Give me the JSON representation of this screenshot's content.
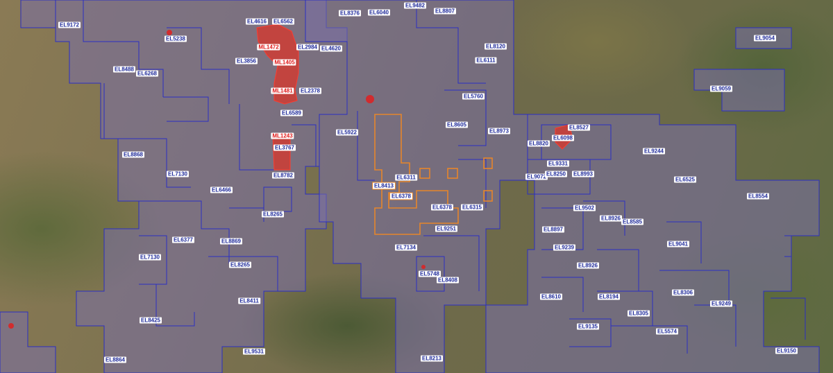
{
  "map": {
    "colors": {
      "exploration_outline": "#2b2fc2",
      "exploration_fill": "#7a6fa8",
      "mining_fill": "#d9352a",
      "application_outline": "#e6862b"
    },
    "labels": [
      {
        "type": "el",
        "text": "EL9172"
      },
      {
        "type": "el",
        "text": "EL5238"
      },
      {
        "type": "el",
        "text": "EL4616"
      },
      {
        "type": "el",
        "text": "EL6562"
      },
      {
        "type": "el",
        "text": "EL8376"
      },
      {
        "type": "el",
        "text": "EL6040"
      },
      {
        "type": "el",
        "text": "EL9482"
      },
      {
        "type": "el",
        "text": "EL8807"
      },
      {
        "type": "ml",
        "text": "ML1472"
      },
      {
        "type": "el",
        "text": "EL2984"
      },
      {
        "type": "el",
        "text": "EL4620"
      },
      {
        "type": "el",
        "text": "EL8120"
      },
      {
        "type": "el",
        "text": "EL9054"
      },
      {
        "type": "el",
        "text": "EL3856"
      },
      {
        "type": "ml",
        "text": "ML1405"
      },
      {
        "type": "el",
        "text": "EL6111"
      },
      {
        "type": "el",
        "text": "EL8488"
      },
      {
        "type": "el",
        "text": "EL6268"
      },
      {
        "type": "ml",
        "text": "ML1481"
      },
      {
        "type": "el",
        "text": "EL2378"
      },
      {
        "type": "el",
        "text": "EL9059"
      },
      {
        "type": "el",
        "text": "EL5760"
      },
      {
        "type": "el",
        "text": "EL6589"
      },
      {
        "type": "el",
        "text": "EL8605"
      },
      {
        "type": "el",
        "text": "EL8527"
      },
      {
        "type": "el",
        "text": "EL5922"
      },
      {
        "type": "el",
        "text": "EL8973"
      },
      {
        "type": "ml",
        "text": "ML1243"
      },
      {
        "type": "el",
        "text": "EL6098"
      },
      {
        "type": "el",
        "text": "EL8820"
      },
      {
        "type": "el",
        "text": "EL3767"
      },
      {
        "type": "el",
        "text": "EL8868"
      },
      {
        "type": "el",
        "text": "EL9244"
      },
      {
        "type": "el",
        "text": "EL9331"
      },
      {
        "type": "el",
        "text": "EL7130"
      },
      {
        "type": "el",
        "text": "EL8782"
      },
      {
        "type": "el",
        "text": "EL6311"
      },
      {
        "type": "el",
        "text": "EL9072"
      },
      {
        "type": "el",
        "text": "EL8250"
      },
      {
        "type": "el",
        "text": "EL8993"
      },
      {
        "type": "el",
        "text": "EL6525"
      },
      {
        "type": "or",
        "text": "EL8413"
      },
      {
        "type": "el",
        "text": "EL6466"
      },
      {
        "type": "or",
        "text": "EL6378"
      },
      {
        "type": "el",
        "text": "EL8554"
      },
      {
        "type": "el",
        "text": "EL6378"
      },
      {
        "type": "el",
        "text": "EL6315"
      },
      {
        "type": "el",
        "text": "EL9502"
      },
      {
        "type": "el",
        "text": "EL8265"
      },
      {
        "type": "el",
        "text": "EL8926"
      },
      {
        "type": "el",
        "text": "EL8585"
      },
      {
        "type": "el",
        "text": "EL9251"
      },
      {
        "type": "el",
        "text": "EL8897"
      },
      {
        "type": "el",
        "text": "EL6377"
      },
      {
        "type": "el",
        "text": "EL8869"
      },
      {
        "type": "el",
        "text": "EL7134"
      },
      {
        "type": "el",
        "text": "EL9239"
      },
      {
        "type": "el",
        "text": "EL9041"
      },
      {
        "type": "el",
        "text": "EL7130"
      },
      {
        "type": "el",
        "text": "EL8265"
      },
      {
        "type": "el",
        "text": "EL8926"
      },
      {
        "type": "el",
        "text": "EL5748"
      },
      {
        "type": "el",
        "text": "EL8408"
      },
      {
        "type": "el",
        "text": "EL8610"
      },
      {
        "type": "el",
        "text": "EL8194"
      },
      {
        "type": "el",
        "text": "EL8306"
      },
      {
        "type": "el",
        "text": "EL8411"
      },
      {
        "type": "el",
        "text": "EL9249"
      },
      {
        "type": "el",
        "text": "EL8305"
      },
      {
        "type": "el",
        "text": "EL8425"
      },
      {
        "type": "el",
        "text": "EL9135"
      },
      {
        "type": "el",
        "text": "EL5574"
      },
      {
        "type": "el",
        "text": "EL9531"
      },
      {
        "type": "el",
        "text": "EL9150"
      },
      {
        "type": "el",
        "text": "EL8864"
      },
      {
        "type": "el",
        "text": "EL8213"
      }
    ]
  }
}
